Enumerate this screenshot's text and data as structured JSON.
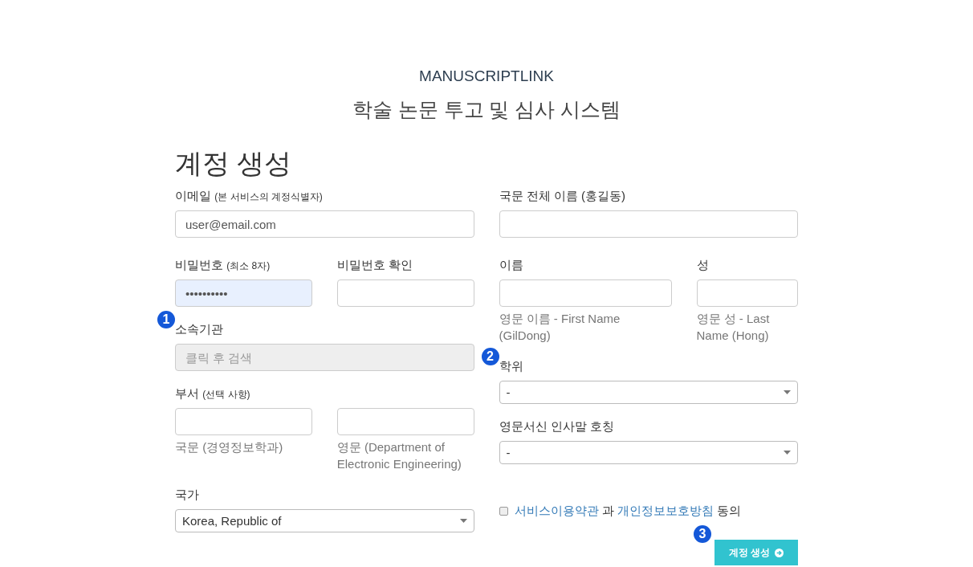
{
  "header": {
    "brand": "MANUSCRIPTLINK",
    "subtitle": "학술 논문 투고 및 심사 시스템"
  },
  "heading": "계정 생성",
  "columns": [
    {
      "rows": [
        {
          "kind": "single",
          "label": "이메일",
          "note": "(본 서비스의 계정식별자)",
          "value": "user@email.com"
        },
        {
          "kind": "pair",
          "items": [
            {
              "label": "비밀번호",
              "note": "(최소 8자)",
              "value": "••••••••••",
              "autofilled": true
            },
            {
              "label": "비밀번호 확인"
            }
          ]
        },
        {
          "kind": "single",
          "label": "소속기관",
          "badge": "1",
          "placeholder": "클릭 후 검색",
          "disabled": true
        },
        {
          "kind": "pair",
          "label": "부서",
          "note": "(선택 사항)",
          "items": [
            {
              "hint": "국문 (경영정보학과)"
            },
            {
              "hint": "영문 (Department of Electronic Engineering)"
            }
          ]
        },
        {
          "kind": "select",
          "label": "국가",
          "value": "Korea, Republic of"
        }
      ]
    },
    {
      "rows": [
        {
          "kind": "single",
          "label": "국문 전체 이름 (홍길동)"
        },
        {
          "kind": "pair",
          "items": [
            {
              "label": "이름",
              "hint": "영문 이름 - First Name (GilDong)",
              "wide": true
            },
            {
              "label": "성",
              "hint": "영문 성 - Last Name (Hong)"
            }
          ]
        },
        {
          "kind": "select",
          "label": "학위",
          "badge": "2",
          "value": "-"
        },
        {
          "kind": "select",
          "label": "영문서신 인사말 호칭",
          "value": "-"
        },
        {
          "kind": "consent",
          "checked": false,
          "parts": [
            {
              "kind": "link",
              "text": "서비스이용약관"
            },
            {
              "kind": "text",
              "text": " 과 "
            },
            {
              "kind": "link",
              "text": "개인정보보호방침"
            },
            {
              "kind": "text",
              "text": " 동의"
            }
          ]
        }
      ]
    }
  ],
  "submit": {
    "label": "계정 생성",
    "badge": "3"
  }
}
